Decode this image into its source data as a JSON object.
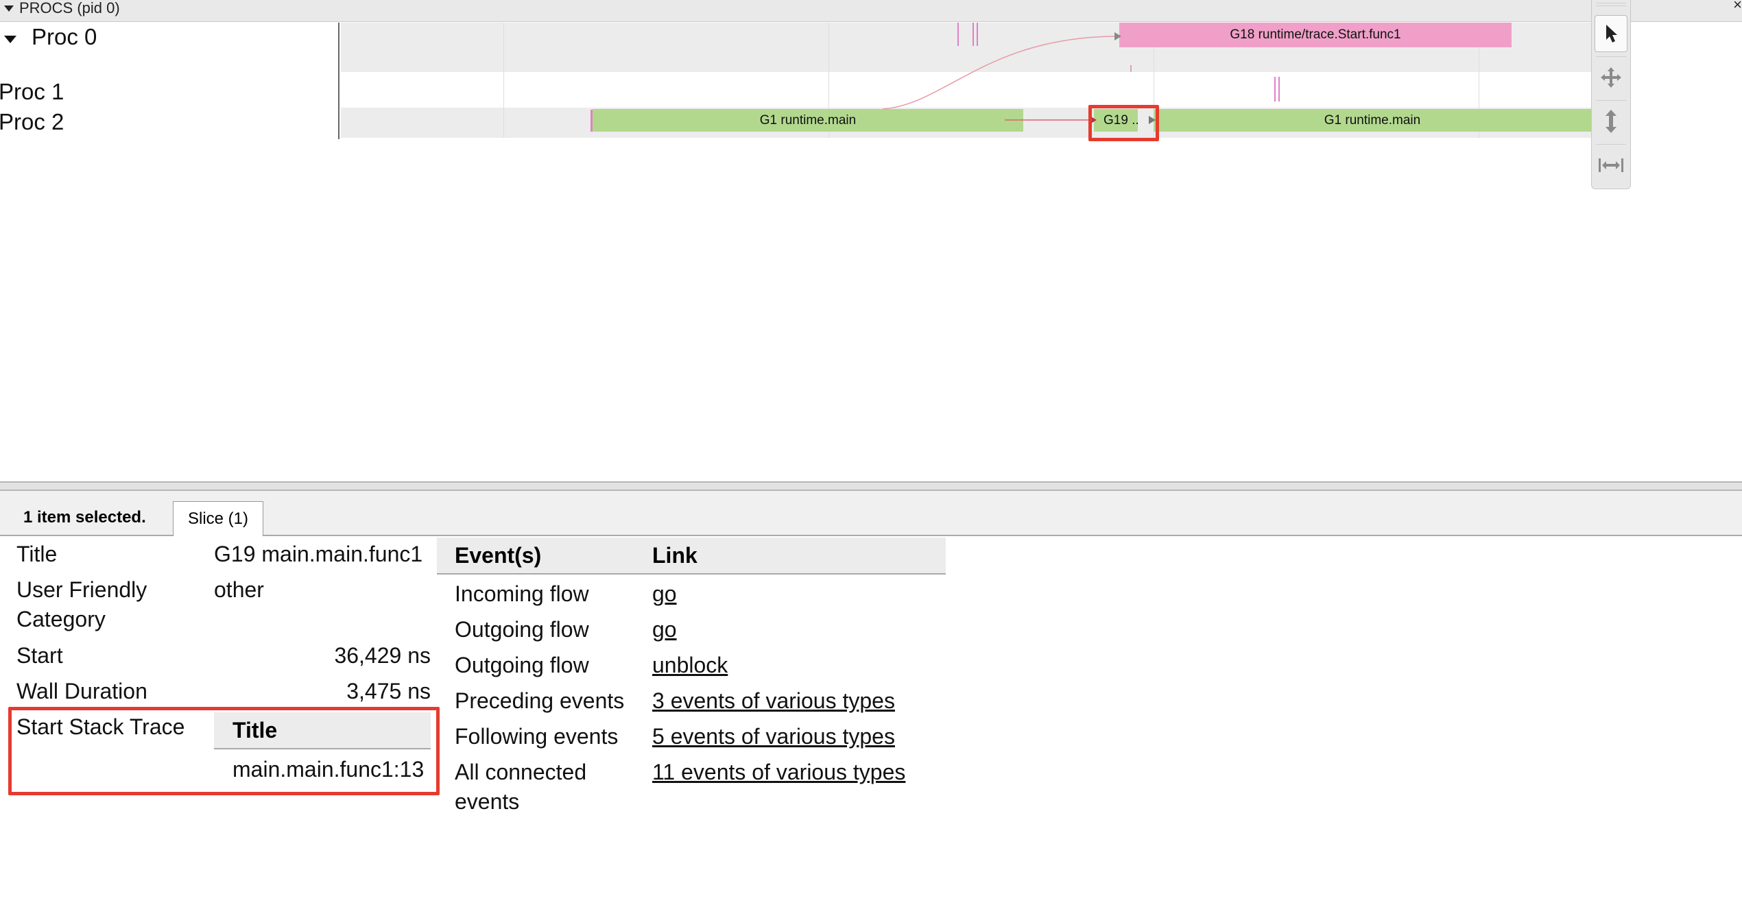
{
  "process_header": {
    "label": "PROCS (pid 0)",
    "close_glyph": "×"
  },
  "tracks": [
    {
      "label": "Proc 0"
    },
    {
      "label": "Proc 1"
    },
    {
      "label": "Proc 2"
    }
  ],
  "slices": {
    "g18": "G18 runtime/trace.Start.func1",
    "g1_left": "G1 runtime.main",
    "g19": "G19 ...",
    "g1_right": "G1 runtime.main"
  },
  "tools": [
    {
      "name": "pointer-icon"
    },
    {
      "name": "pan-icon"
    },
    {
      "name": "zoom-icon"
    },
    {
      "name": "timing-icon"
    }
  ],
  "details": {
    "selected_count": "1 item selected.",
    "tab_label": "Slice (1)",
    "fields": {
      "title_key": "Title",
      "title_val": "G19 main.main.func1",
      "ufc_key_line1": "User Friendly",
      "ufc_key_line2": "Category",
      "ufc_val": "other",
      "start_key": "Start",
      "start_val": "36,429 ns",
      "wall_key": "Wall Duration",
      "wall_val": "3,475 ns",
      "stack_key": "Start Stack Trace",
      "stack_col": "Title",
      "stack_val": "main.main.func1:13"
    },
    "events_table": {
      "col_event": "Event(s)",
      "col_link": "Link",
      "rows": [
        {
          "event": "Incoming flow",
          "link": "go"
        },
        {
          "event": "Outgoing flow",
          "link": "go"
        },
        {
          "event": "Outgoing flow",
          "link": "unblock"
        },
        {
          "event": "Preceding events",
          "link": "3 events of various types"
        },
        {
          "event": "Following events",
          "link": "5 events of various types"
        },
        {
          "event": "All connected",
          "event_line2": "events",
          "link": "11 events of various types"
        }
      ]
    }
  },
  "colors": {
    "running_slice": "#b2d88e",
    "gc_slice": "#f0a0c8",
    "highlight": "#e53b2e"
  }
}
